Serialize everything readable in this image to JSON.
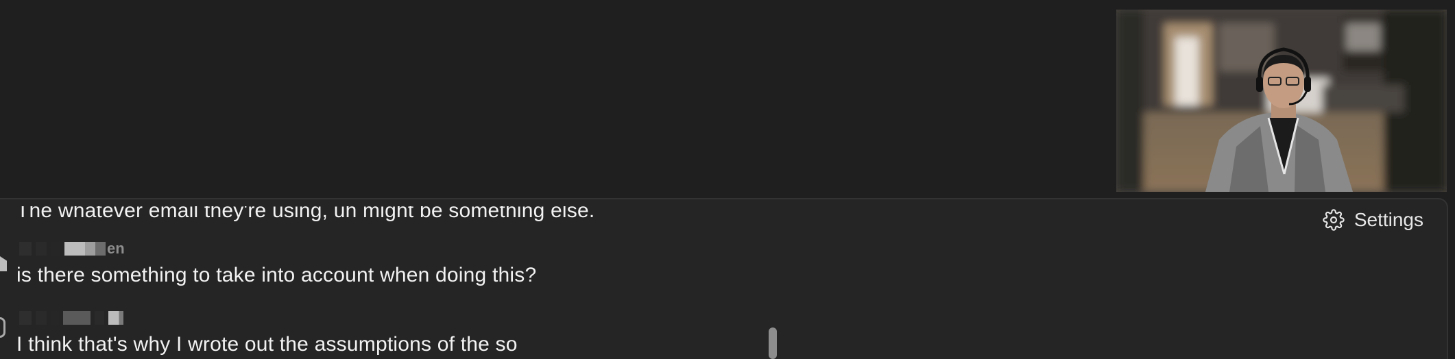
{
  "captions": {
    "line_1": "The whatever email they're using, uh might be something else.",
    "line_2": "is there something to take into account when doing this?",
    "line_3": "I think that's why I wrote out the assumptions of the so",
    "speaker_1_suffix": "en"
  },
  "settings": {
    "label": "Settings",
    "icon": "gear-icon"
  },
  "colors": {
    "background": "#1f1f1f",
    "panel": "#252525",
    "text": "#f2f2f2"
  }
}
